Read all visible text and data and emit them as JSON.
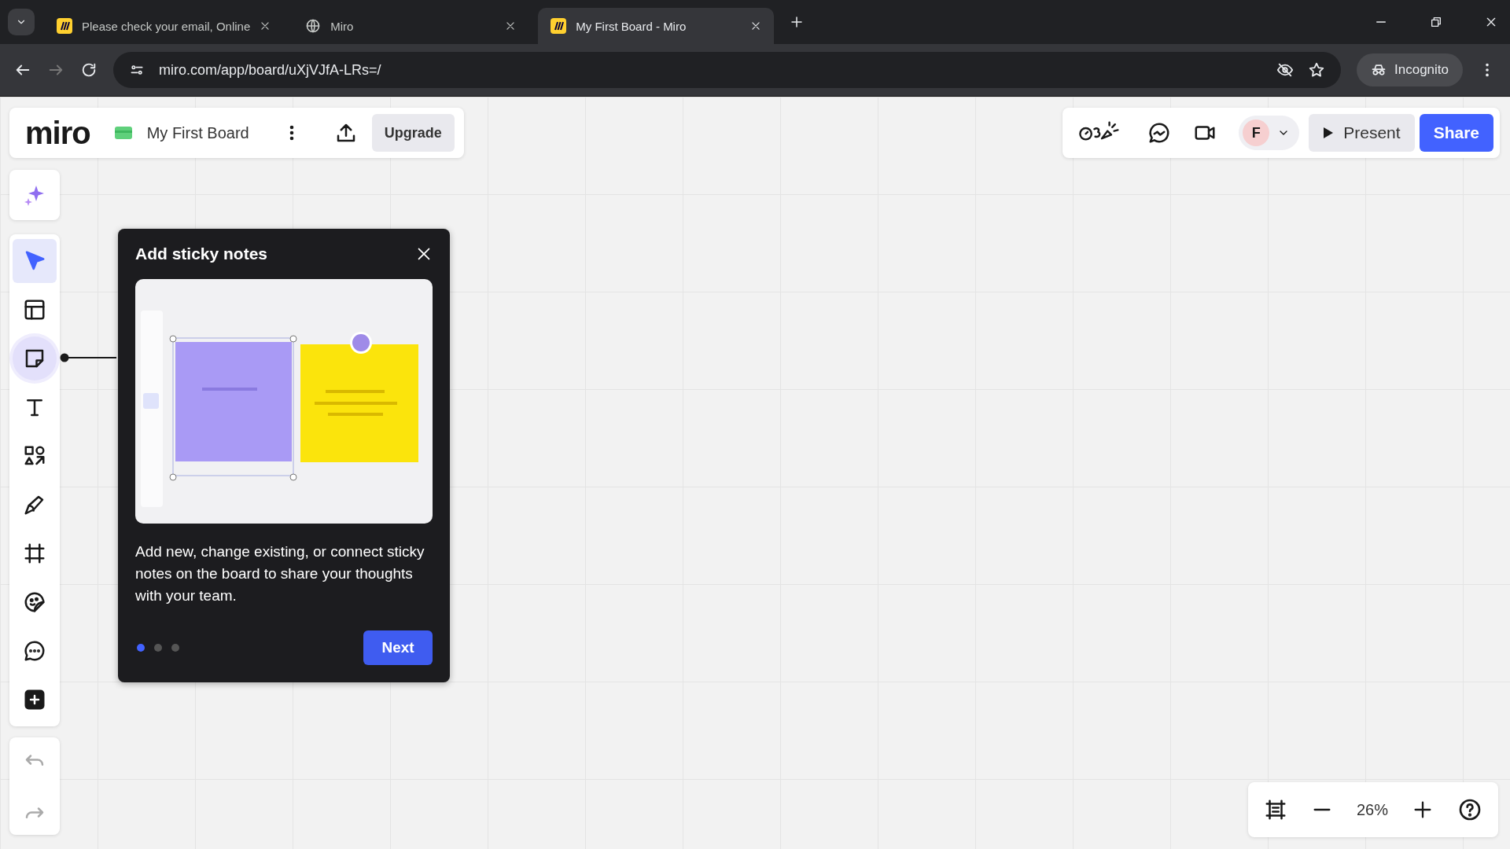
{
  "browser": {
    "tabs": [
      {
        "title": "Please check your email, Online",
        "kind": "miro",
        "selected": false
      },
      {
        "title": "Miro",
        "kind": "globe",
        "selected": false
      },
      {
        "title": "My First Board - Miro",
        "kind": "miro",
        "selected": true
      }
    ],
    "url": "miro.com/app/board/uXjVJfA-LRs=/",
    "profile": "Incognito"
  },
  "board": {
    "logo": "miro",
    "title": "My First Board",
    "upgrade": "Upgrade",
    "avatar": "F",
    "present": "Present",
    "share": "Share"
  },
  "tools": [
    {
      "kind": "select",
      "selected": true,
      "highlighted": false
    },
    {
      "kind": "templates",
      "selected": false,
      "highlighted": false
    },
    {
      "kind": "sticky",
      "selected": false,
      "highlighted": true
    },
    {
      "kind": "text",
      "selected": false,
      "highlighted": false
    },
    {
      "kind": "shapes",
      "selected": false,
      "highlighted": false
    },
    {
      "kind": "pen",
      "selected": false,
      "highlighted": false
    },
    {
      "kind": "frame",
      "selected": false,
      "highlighted": false
    },
    {
      "kind": "stickers",
      "selected": false,
      "highlighted": false
    },
    {
      "kind": "comment",
      "selected": false,
      "highlighted": false
    },
    {
      "kind": "more",
      "selected": false,
      "highlighted": false
    }
  ],
  "popup": {
    "title": "Add sticky notes",
    "text": "Add new, change existing, or connect sticky notes on the board to share your thoughts with your team.",
    "steps": [
      {
        "selected": true
      },
      {
        "selected": false
      },
      {
        "selected": false
      }
    ],
    "button": "Next"
  },
  "zoom": {
    "value": "26%"
  }
}
